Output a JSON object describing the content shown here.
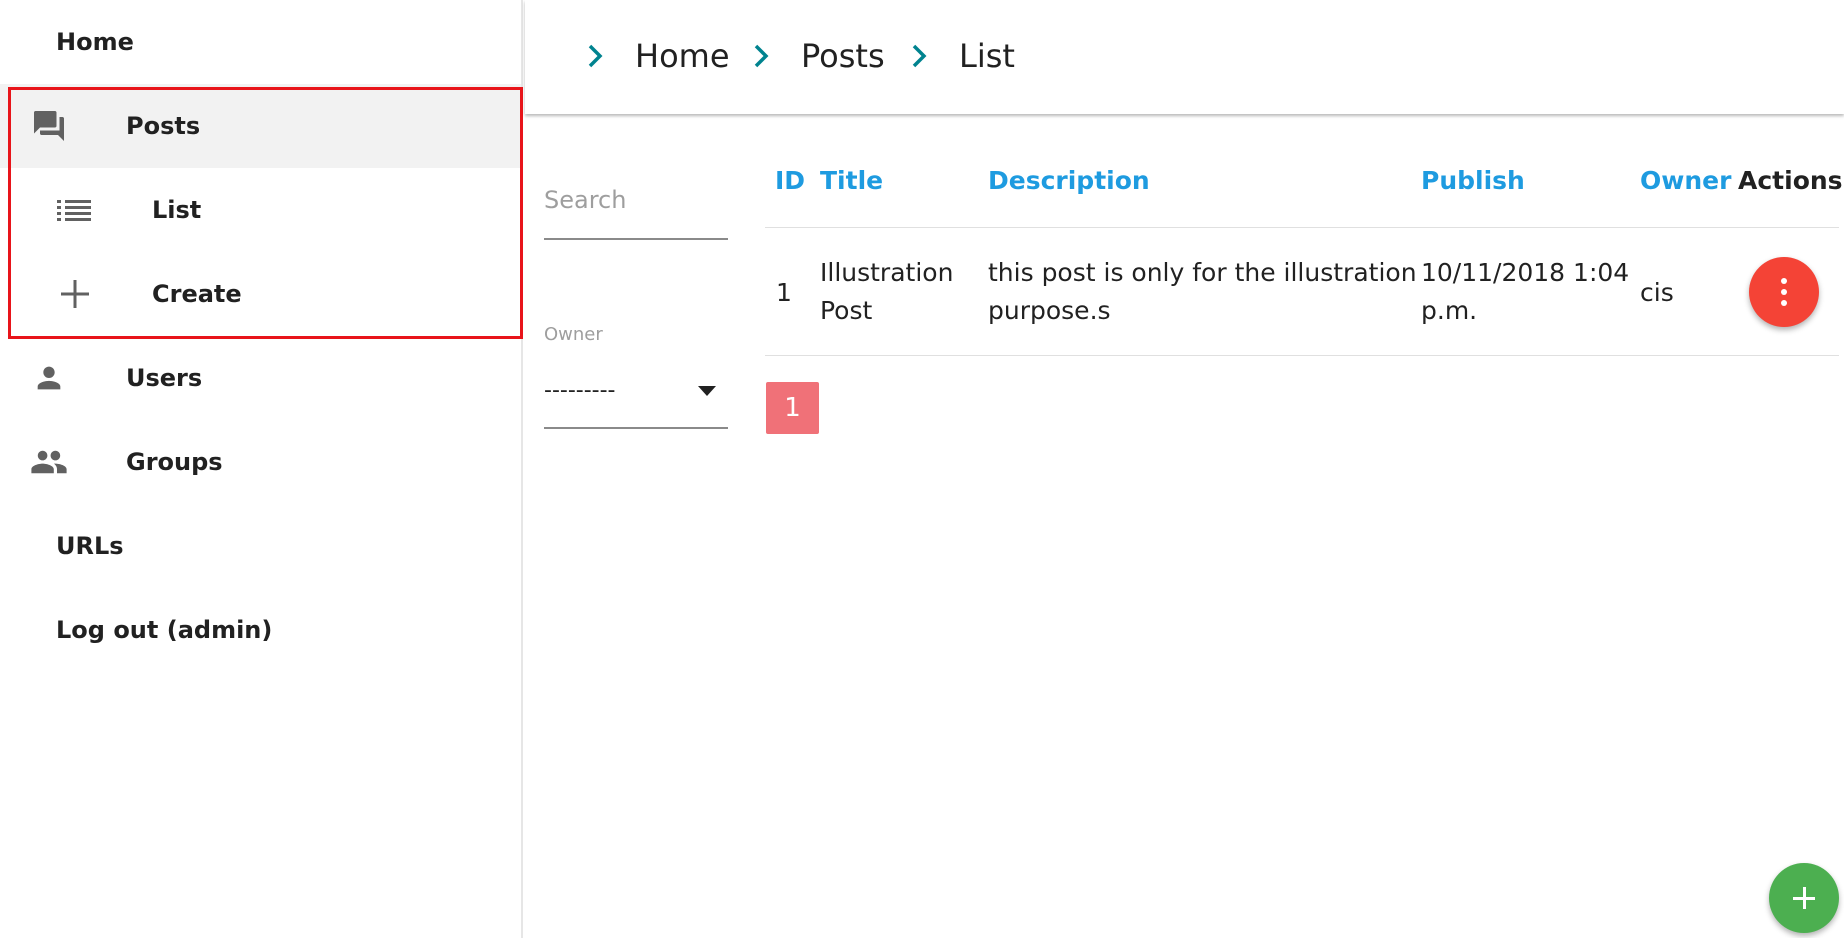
{
  "sidebar": {
    "items": [
      {
        "label": "Home",
        "icon": ""
      },
      {
        "label": "Posts",
        "icon": "forum-icon",
        "active": true
      },
      {
        "label": "List",
        "icon": "list-icon"
      },
      {
        "label": "Create",
        "icon": "plus-icon"
      },
      {
        "label": "Users",
        "icon": "person-icon"
      },
      {
        "label": "Groups",
        "icon": "group-icon"
      },
      {
        "label": "URLs",
        "icon": ""
      },
      {
        "label": "Log out (admin)",
        "icon": ""
      }
    ]
  },
  "breadcrumb": [
    "Home",
    "Posts",
    "List"
  ],
  "filters": {
    "search_placeholder": "Search",
    "owner_label": "Owner",
    "owner_value": "---------"
  },
  "table": {
    "headers": [
      "ID",
      "Title",
      "Description",
      "Publish",
      "Owner",
      "Actions"
    ],
    "rows": [
      {
        "id": "1",
        "title_line1": "Illustration",
        "title_line2": "Post",
        "desc_line1": "this post is only for the illustration",
        "desc_line2": "purpose.s",
        "publish_line1": "10/11/2018 1:04",
        "publish_line2": "p.m.",
        "owner": "cis"
      }
    ]
  },
  "pagination": {
    "current_page": "1"
  },
  "colors": {
    "accent_blue": "#1e9be0",
    "teal_chevron": "#00838f",
    "action_red": "#f44336",
    "fab_green": "#4caf50",
    "page_active": "#f07178",
    "highlight_red": "#e8141a"
  }
}
